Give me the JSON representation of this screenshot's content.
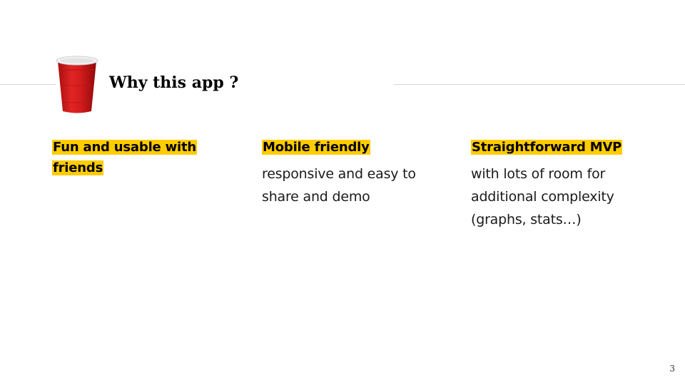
{
  "slide": {
    "title": "Why this app ?",
    "page_number": "3"
  },
  "icons": {
    "cup": "red-party-cup-icon"
  },
  "colors": {
    "highlight": "#ffcc00",
    "cup_red": "#d81b1b"
  },
  "columns": [
    {
      "heading": "Fun and usable with friends",
      "body": ""
    },
    {
      "heading": "Mobile friendly",
      "body": "responsive and easy to share and demo"
    },
    {
      "heading": "Straightforward MVP",
      "body": "with lots of room for additional complexity (graphs, stats…)"
    }
  ]
}
